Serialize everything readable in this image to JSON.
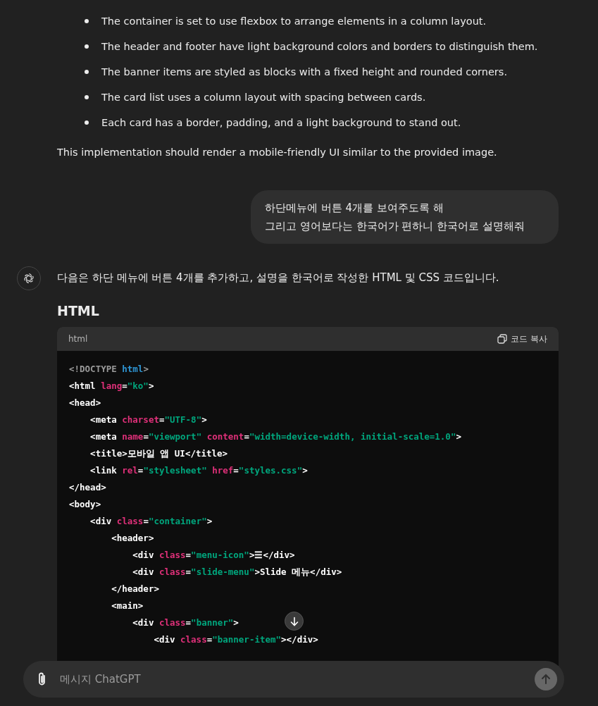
{
  "assistant_previous": {
    "bullets": [
      "The container is set to use flexbox to arrange elements in a column layout.",
      "The header and footer have light background colors and borders to distinguish them.",
      "The banner items are styled as blocks with a fixed height and rounded corners.",
      "The card list uses a column layout with spacing between cards.",
      "Each card has a border, padding, and a light background to stand out."
    ],
    "paragraph": "This implementation should render a mobile-friendly UI similar to the provided image."
  },
  "user_message": [
    "하단메뉴에 버튼 4개를 보여주도록 해",
    "그리고 영어보다는 한국어가 편하니 한국어로 설명해줘"
  ],
  "assistant_reply": {
    "intro": "다음은 하단 메뉴에 버튼 4개를 추가하고, 설명을 한국어로 작성한 HTML 및 CSS 코드입니다.",
    "heading": "HTML",
    "code_block": {
      "language": "html",
      "copy_label": "코드 복사",
      "lines": [
        [
          {
            "kind": "doctype",
            "text": "<!DOCTYPE "
          },
          {
            "kind": "keyword",
            "text": "html"
          },
          {
            "kind": "doctype",
            "text": ">"
          }
        ],
        [
          {
            "kind": "tag",
            "text": "<html "
          },
          {
            "kind": "attr",
            "text": "lang"
          },
          {
            "kind": "tag",
            "text": "="
          },
          {
            "kind": "string",
            "text": "\"ko\""
          },
          {
            "kind": "tag",
            "text": ">"
          }
        ],
        [
          {
            "kind": "tag",
            "text": "<head>"
          }
        ],
        [
          {
            "kind": "tag",
            "text": "    <meta "
          },
          {
            "kind": "attr",
            "text": "charset"
          },
          {
            "kind": "tag",
            "text": "="
          },
          {
            "kind": "string",
            "text": "\"UTF-8\""
          },
          {
            "kind": "tag",
            "text": ">"
          }
        ],
        [
          {
            "kind": "tag",
            "text": "    <meta "
          },
          {
            "kind": "attr",
            "text": "name"
          },
          {
            "kind": "tag",
            "text": "="
          },
          {
            "kind": "string",
            "text": "\"viewport\""
          },
          {
            "kind": "attr",
            "text": " content"
          },
          {
            "kind": "tag",
            "text": "="
          },
          {
            "kind": "string",
            "text": "\"width=device-width, initial-scale=1.0\""
          },
          {
            "kind": "tag",
            "text": ">"
          }
        ],
        [
          {
            "kind": "tag",
            "text": "    <title>모바일 앱 UI</title>"
          }
        ],
        [
          {
            "kind": "tag",
            "text": "    <link "
          },
          {
            "kind": "attr",
            "text": "rel"
          },
          {
            "kind": "tag",
            "text": "="
          },
          {
            "kind": "string",
            "text": "\"stylesheet\""
          },
          {
            "kind": "attr",
            "text": " href"
          },
          {
            "kind": "tag",
            "text": "="
          },
          {
            "kind": "string",
            "text": "\"styles.css\""
          },
          {
            "kind": "tag",
            "text": ">"
          }
        ],
        [
          {
            "kind": "tag",
            "text": "</head>"
          }
        ],
        [
          {
            "kind": "tag",
            "text": "<body>"
          }
        ],
        [
          {
            "kind": "tag",
            "text": "    <div "
          },
          {
            "kind": "attr",
            "text": "class"
          },
          {
            "kind": "tag",
            "text": "="
          },
          {
            "kind": "string",
            "text": "\"container\""
          },
          {
            "kind": "tag",
            "text": ">"
          }
        ],
        [
          {
            "kind": "tag",
            "text": "        <header>"
          }
        ],
        [
          {
            "kind": "tag",
            "text": "            <div "
          },
          {
            "kind": "attr",
            "text": "class"
          },
          {
            "kind": "tag",
            "text": "="
          },
          {
            "kind": "string",
            "text": "\"menu-icon\""
          },
          {
            "kind": "tag",
            "text": ">☰</div>"
          }
        ],
        [
          {
            "kind": "tag",
            "text": "            <div "
          },
          {
            "kind": "attr",
            "text": "class"
          },
          {
            "kind": "tag",
            "text": "="
          },
          {
            "kind": "string",
            "text": "\"slide-menu\""
          },
          {
            "kind": "tag",
            "text": ">Slide 메뉴</div>"
          }
        ],
        [
          {
            "kind": "tag",
            "text": "        </header>"
          }
        ],
        [
          {
            "kind": "tag",
            "text": "        <main>"
          }
        ],
        [
          {
            "kind": "tag",
            "text": "            <div "
          },
          {
            "kind": "attr",
            "text": "class"
          },
          {
            "kind": "tag",
            "text": "="
          },
          {
            "kind": "string",
            "text": "\"banner\""
          },
          {
            "kind": "tag",
            "text": ">"
          }
        ],
        [
          {
            "kind": "tag",
            "text": "                <div "
          },
          {
            "kind": "attr",
            "text": "class"
          },
          {
            "kind": "tag",
            "text": "="
          },
          {
            "kind": "string",
            "text": "\"banner-item\""
          },
          {
            "kind": "tag",
            "text": "></div>"
          }
        ]
      ]
    }
  },
  "composer": {
    "placeholder": "메시지 ChatGPT"
  }
}
